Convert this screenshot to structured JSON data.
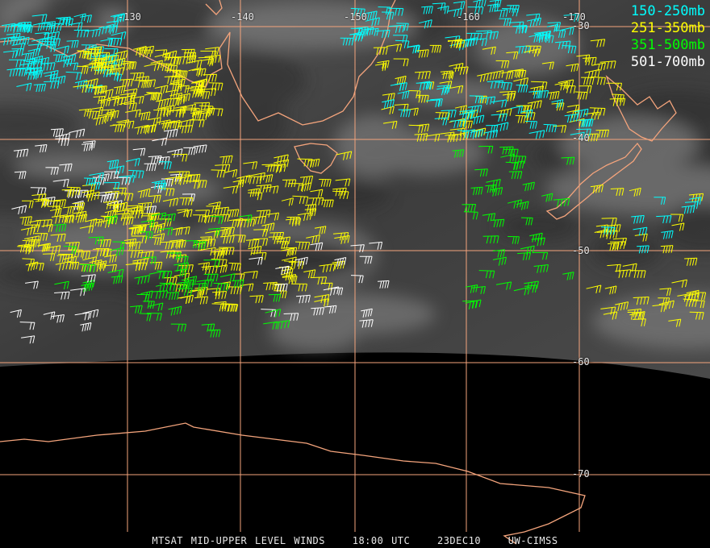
{
  "legend": [
    {
      "label": "150-250mb",
      "color": "#00ffff"
    },
    {
      "label": "251-350mb",
      "color": "#ffff00"
    },
    {
      "label": "351-500mb",
      "color": "#00ff00"
    },
    {
      "label": "501-700mb",
      "color": "#ffffff"
    }
  ],
  "longitude_labels": [
    "-130",
    "-140",
    "-150",
    "-160",
    "-170"
  ],
  "latitude_labels": [
    "-30",
    "-40",
    "-50",
    "-60",
    "-70"
  ],
  "footer": {
    "product": "MTSAT MID-UPPER LEVEL WINDS",
    "time": "18:00 UTC",
    "date": "23DEC10",
    "source": "UW-CIMSS"
  },
  "colors": {
    "grid": "#f4a47c",
    "coast": "#f4a47c",
    "background": "#000000"
  }
}
